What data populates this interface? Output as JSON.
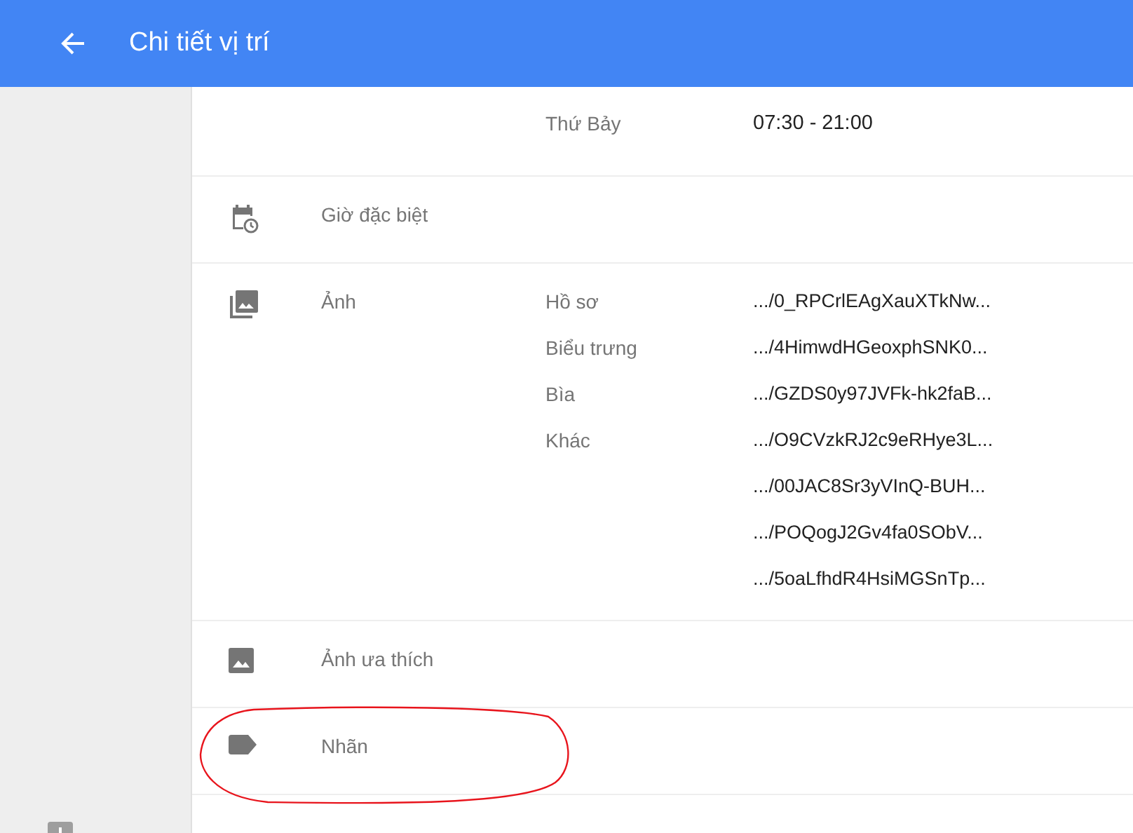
{
  "app_bar": {
    "title": "Chi tiết vị trí"
  },
  "sections": [
    {
      "kind": "hours",
      "entries": [
        {
          "name": "Thứ Bảy",
          "value": "07:30 - 21:00"
        }
      ]
    },
    {
      "kind": "special_hours",
      "label": "Giờ đặc biệt"
    },
    {
      "kind": "photos",
      "label": "Ảnh",
      "entries": [
        {
          "name": "Hồ sơ",
          "value": ".../0_RPCrlEAgXauXTkNw..."
        },
        {
          "name": "Biểu trưng",
          "value": ".../4HimwdHGeoxphSNK0..."
        },
        {
          "name": "Bìa",
          "value": ".../GZDS0y97JVFk-hk2faB..."
        },
        {
          "name": "Khác",
          "value": ".../O9CVzkRJ2c9eRHye3L..."
        },
        {
          "value": ".../00JAC8Sr3yVInQ-BUH..."
        },
        {
          "value": ".../POQogJ2Gv4fa0SObV..."
        },
        {
          "value": ".../5oaLfhdR4HsiMGSnTp..."
        }
      ]
    },
    {
      "kind": "favorite_photo",
      "label": "Ảnh ưa thích"
    },
    {
      "kind": "labels",
      "label": "Nhãn"
    }
  ]
}
